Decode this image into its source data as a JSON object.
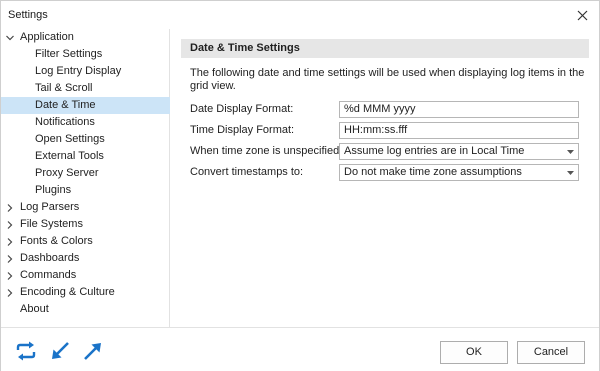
{
  "window": {
    "title": "Settings"
  },
  "sidebar": {
    "items": [
      {
        "label": "Application",
        "level": 0,
        "expanded": true,
        "selected": false
      },
      {
        "label": "Filter Settings",
        "level": 1,
        "selected": false
      },
      {
        "label": "Log Entry Display",
        "level": 1,
        "selected": false
      },
      {
        "label": "Tail & Scroll",
        "level": 1,
        "selected": false
      },
      {
        "label": "Date & Time",
        "level": 1,
        "selected": true
      },
      {
        "label": "Notifications",
        "level": 1,
        "selected": false
      },
      {
        "label": "Open Settings",
        "level": 1,
        "selected": false
      },
      {
        "label": "External Tools",
        "level": 1,
        "selected": false
      },
      {
        "label": "Proxy Server",
        "level": 1,
        "selected": false
      },
      {
        "label": "Plugins",
        "level": 1,
        "selected": false
      },
      {
        "label": "Log Parsers",
        "level": 0,
        "expanded": false,
        "selected": false
      },
      {
        "label": "File Systems",
        "level": 0,
        "expanded": false,
        "selected": false
      },
      {
        "label": "Fonts & Colors",
        "level": 0,
        "expanded": false,
        "selected": false
      },
      {
        "label": "Dashboards",
        "level": 0,
        "expanded": false,
        "selected": false
      },
      {
        "label": "Commands",
        "level": 0,
        "expanded": false,
        "selected": false
      },
      {
        "label": "Encoding & Culture",
        "level": 0,
        "expanded": false,
        "selected": false
      },
      {
        "label": "About",
        "level": 0,
        "selected": false
      }
    ]
  },
  "main": {
    "header": "Date & Time Settings",
    "description": "The following date and time settings will be used when displaying log items in the grid view.",
    "fields": {
      "date_format": {
        "label": "Date Display Format:",
        "value": "%d MMM yyyy"
      },
      "time_format": {
        "label": "Time Display Format:",
        "value": "HH:mm:ss.fff"
      },
      "timezone_unspecified": {
        "label": "When time zone is unspecified:",
        "value": "Assume log entries are in Local Time"
      },
      "convert_timestamps": {
        "label": "Convert timestamps to:",
        "value": "Do not make time zone assumptions"
      }
    }
  },
  "footer": {
    "icons": [
      "sync-icon",
      "import-arrow-icon",
      "export-arrow-icon"
    ],
    "ok_label": "OK",
    "cancel_label": "Cancel"
  },
  "colors": {
    "selection": "#cce4f7",
    "accent": "#1a73c8",
    "section_header_bg": "#e6e6e6"
  }
}
